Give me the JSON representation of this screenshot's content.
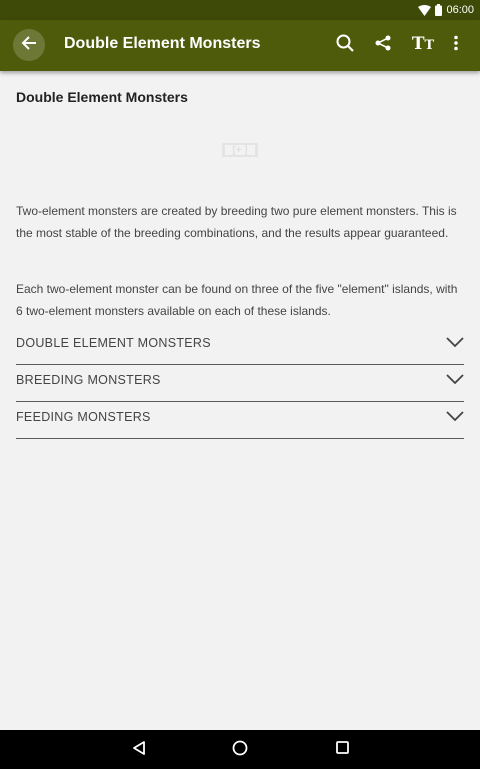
{
  "status_bar": {
    "time": "06:00",
    "icons": [
      "wifi-icon",
      "battery-icon"
    ]
  },
  "app_bar": {
    "title": "Double Element Monsters",
    "actions": [
      "back-arrow-icon",
      "search-icon",
      "share-icon",
      "text-size-icon",
      "more-vert-icon"
    ],
    "text_size_large": "T",
    "text_size_small": "T"
  },
  "article": {
    "title": "Double Element Monsters",
    "image_alt": "[+ ]",
    "paragraphs": [
      "Two-element monsters are created by breeding two pure element monsters.  This is the most stable of the breeding combinations, and the results appear guaranteed.",
      "Each two-element monster can be found on three of the five \"element\" islands, with 6 two-element monsters available on each of these islands."
    ],
    "sections": [
      {
        "label": "DOUBLE ELEMENT MONSTERS"
      },
      {
        "label": "BREEDING MONSTERS"
      },
      {
        "label": "FEEDING MONSTERS"
      }
    ]
  },
  "nav_bar": {
    "buttons": [
      "back-triangle-icon",
      "home-circle-icon",
      "recents-square-icon"
    ]
  },
  "colors": {
    "status_bar": "#3e4a08",
    "app_bar": "#4d5b0b",
    "background": "#f2f2f2"
  }
}
